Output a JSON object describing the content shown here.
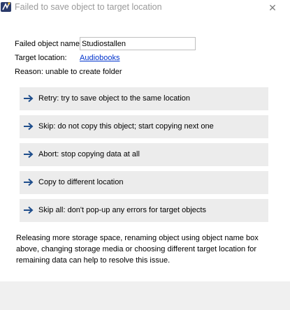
{
  "window": {
    "title": "Failed to save object to target location",
    "icon": "app-logo-icon",
    "close_glyph": "✕"
  },
  "details": {
    "object_name_label": "Failed object name:",
    "object_name_value": "Studiostallen",
    "target_label": "Target location:",
    "target_link": "Audiobooks",
    "reason": "Reason: unable to create folder"
  },
  "commands": [
    {
      "label": "Retry: try to save object to the same location"
    },
    {
      "label": "Skip: do not copy this object; start copying next one"
    },
    {
      "label": "Abort: stop copying data at all"
    },
    {
      "label": "Copy to different location"
    },
    {
      "label": "Skip all: don't pop-up any errors for target objects"
    }
  ],
  "info_text": "Releasing more storage space, renaming object using object name box above, changing storage media or choosing different target location for remaining data can help to resolve this issue.",
  "colors": {
    "command_bg": "#ececec",
    "arrow": "#1f4e8c",
    "link": "#0033cc",
    "footer_bg": "#f0f0f0"
  }
}
